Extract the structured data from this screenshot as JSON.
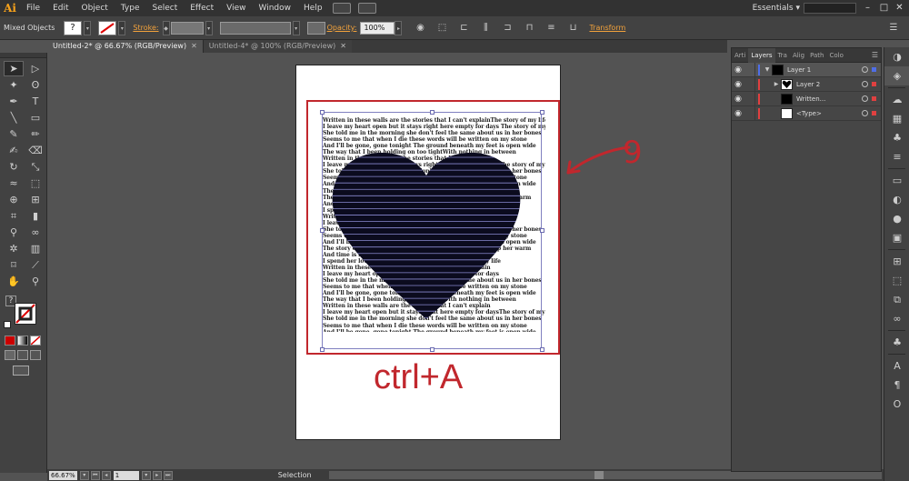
{
  "app": {
    "logo": "Ai",
    "workspace": "Essentials"
  },
  "menu": [
    "File",
    "Edit",
    "Object",
    "Type",
    "Select",
    "Effect",
    "View",
    "Window",
    "Help"
  ],
  "window_controls": {
    "minimize": "–",
    "maximize": "□",
    "close": "✕"
  },
  "control_bar": {
    "selection_label": "Mixed Objects",
    "stroke_label": "Stroke:",
    "opacity_label": "Opacity:",
    "opacity_value": "100%",
    "transform_label": "Transform"
  },
  "tabs": [
    {
      "label": "Untitled-2* @ 66.67% (RGB/Preview)",
      "active": true
    },
    {
      "label": "Untitled-4* @ 100% (RGB/Preview)",
      "active": false
    }
  ],
  "tools": [
    "selection-tool",
    "direct-selection-tool",
    "magic-wand-tool",
    "lasso-tool",
    "pen-tool",
    "type-tool",
    "line-tool",
    "rectangle-tool",
    "paintbrush-tool",
    "pencil-tool",
    "blob-brush-tool",
    "eraser-tool",
    "rotate-tool",
    "scale-tool",
    "width-tool",
    "free-transform-tool",
    "shape-builder-tool",
    "perspective-grid-tool",
    "mesh-tool",
    "gradient-tool",
    "eyedropper-tool",
    "blend-tool",
    "symbol-sprayer-tool",
    "column-graph-tool",
    "artboard-tool",
    "slice-tool",
    "hand-tool",
    "zoom-tool"
  ],
  "artwork": {
    "text_lines": [
      "Written in these walls are the stories that I can't explainThe story of my life",
      "I leave my heart open but it stays right here empty for days The story of my life",
      "She told me in the morning she don't feel the same about us in her bones",
      "Seems to me that when I die these words will be written on my stone",
      "And I'll be gone, gone tonight The ground beneath my feet is open wide",
      "The way that I been holding on too tightWith nothing in between",
      "Written in these walls are the stories that I can't explain",
      "I leave my heart open but it stays right here empty for daysThe story of my life",
      "She told me in the morning she don't feel the same about us in her bones",
      "Seems to me that when I die these words will be written on my stone",
      "And I'll be gone, gone tonight The ground beneath my feet is open wide",
      "The way that I been holding on too tightWith nothing in between",
      "The story of my life I take her home I drive all night to keep her warm",
      "And time is frozen The story of my life I give her hope",
      "I spend her love until she's broke inside The story of my life",
      "Written in these walls are the stories that I can't explain",
      "I leave my heart open but it stays right here empty for days",
      "She told me in the morning she don't feel the same about us in her bones",
      "Seems to me that when I die these words will be written on my stone",
      "And I'll be gone, gone tonight The ground beneath my feet is open wide",
      "The story of my life I take her home I drive all night to keep her warm",
      "And time is frozen The story of my life I give her hope",
      "I spend her love until she's broke inside The story of my life",
      "Written in these walls are the stories that I can't explain",
      "I leave my heart open but it stays right here empty for days",
      "She told me in the morning she don't feel the same about us in her bones",
      "Seems to me that when I die these words will be written on my stone",
      "And I'll be gone, gone tonight The ground beneath my feet is open wide",
      "The way that I been holding on too tightWith nothing in between",
      "Written in these walls are the stories that I can't explain",
      "I leave my heart open but it stays right here empty for daysThe story of my life",
      "She told me in the morning she don't feel the same about us in her bones",
      "Seems to me that when I die these words will be written on my stone",
      "And I'll be gone, gone tonight The ground beneath my feet is open wide",
      "The way that I been holding on too tightWith nothing in between",
      "The story of my lifeWritten in these walls are the stories that I can't explain"
    ],
    "shortcut_text": "ctrl+A",
    "annotation_number": "9",
    "accent_color": "#c1272d"
  },
  "status_bar": {
    "zoom": "66.67%",
    "artboard": "1",
    "mode": "Selection"
  },
  "layers_panel": {
    "tabs": [
      "Arti",
      "Layers",
      "Tra",
      "Alig",
      "Path",
      "Colo"
    ],
    "rows": [
      {
        "label": "Layer 1",
        "expanded": true,
        "color": "#4f6ee8"
      },
      {
        "label": "Layer 2",
        "expanded": false,
        "color": "#e04040"
      },
      {
        "label": "Written...",
        "expanded": false,
        "color": "#e04040"
      },
      {
        "label": "<Type>",
        "expanded": false,
        "color": "#e04040"
      }
    ]
  },
  "dock_icons": [
    "color-icon",
    "layers-icon",
    "brushes-icon",
    "swatches-icon",
    "symbols-icon",
    "stroke-icon",
    "gradient-icon",
    "transparency-icon",
    "appearance-icon",
    "graphic-styles-icon",
    "align-icon",
    "transform-icon",
    "pathfinder-icon",
    "links-icon",
    "club-icon",
    "character-icon",
    "paragraph-icon",
    "opentype-icon"
  ]
}
